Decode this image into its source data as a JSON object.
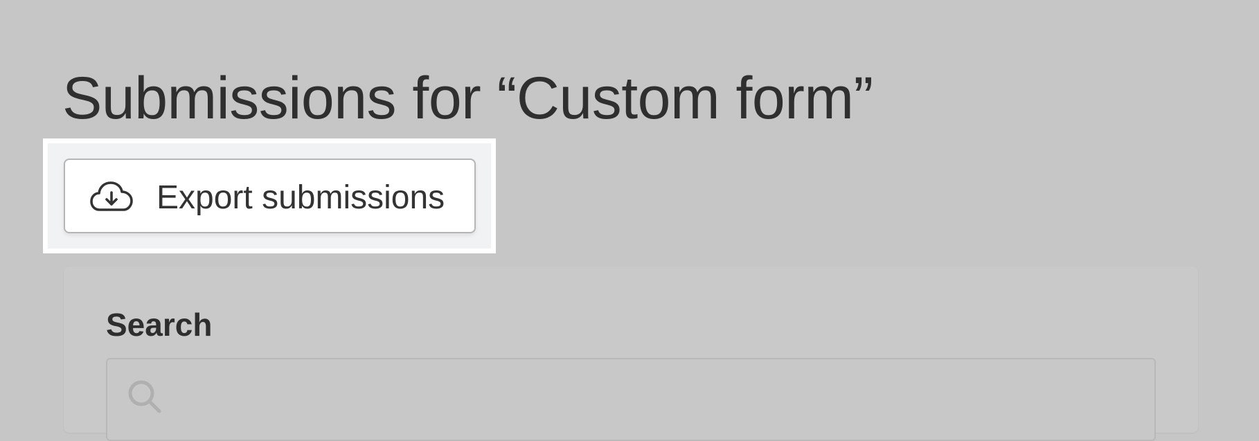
{
  "header": {
    "title": "Submissions for “Custom form”"
  },
  "toolbar": {
    "export_label": "Export submissions",
    "export_icon": "cloud-download-icon"
  },
  "search": {
    "label": "Search",
    "value": "",
    "placeholder": "",
    "icon": "search-icon"
  },
  "colors": {
    "overlay": "#c6c6c6",
    "highlight_border": "#ffffff",
    "button_bg": "#ffffff",
    "text": "#2f2f2f"
  }
}
